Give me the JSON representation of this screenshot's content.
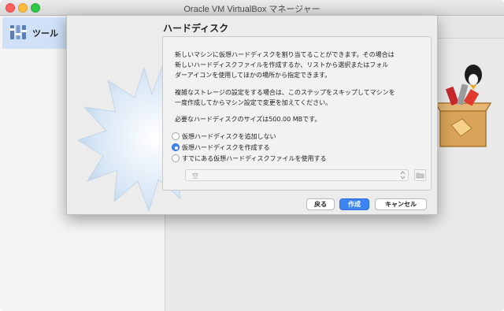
{
  "window": {
    "title": "Oracle VM VirtualBox マネージャー"
  },
  "sidebar": {
    "tools_label": "ツール"
  },
  "dialog": {
    "title": "ハードディスク",
    "paragraph1": [
      "新しいマシンに仮想ハードディスクを割り当てることができます。その場合は",
      "新しいハードディスクファイルを作成するか、リストから選択またはフォル",
      "ダーアイコンを使用してほかの場所から指定できます。"
    ],
    "paragraph2": [
      "複雑なストレージの設定をする場合は、このステップをスキップしてマシンを",
      "一度作成してからマシン設定で変更を加えてください。"
    ],
    "recommended_size": "必要なハードディスクのサイズは500.00 MBです。",
    "options": [
      {
        "label": "仮想ハードディスクを追加しない",
        "selected": false
      },
      {
        "label": "仮想ハードディスクを作成する",
        "selected": true
      },
      {
        "label": "すでにある仮想ハードディスクファイルを使用する",
        "selected": false
      }
    ],
    "file_select_value": "空",
    "buttons": {
      "back": "戻る",
      "create": "作成",
      "cancel": "キャンセル"
    }
  },
  "colors": {
    "accent": "#3e84f3",
    "sidebar_selected": "#cfe0f7"
  },
  "icons": [
    "tools-icon",
    "burst-decoration-icon",
    "folder-icon",
    "chevron-updown-icon",
    "toolbox-penguin-icon"
  ]
}
